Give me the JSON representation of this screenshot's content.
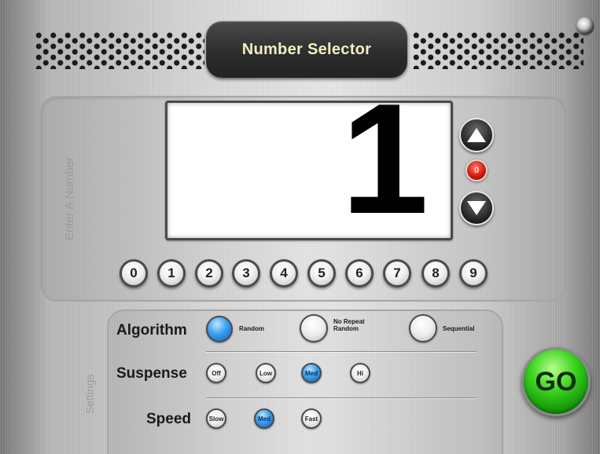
{
  "app": {
    "title": "Number Selector"
  },
  "entry": {
    "label": "Enter A Number",
    "value": "1"
  },
  "controls": {
    "reset_label": "0"
  },
  "keypad": {
    "digits": [
      "0",
      "1",
      "2",
      "3",
      "4",
      "5",
      "6",
      "7",
      "8",
      "9"
    ]
  },
  "settings": {
    "label": "Settings",
    "algorithm": {
      "label": "Algorithm",
      "options": [
        {
          "label": "Random",
          "selected": true
        },
        {
          "label": "No Repeat Random",
          "selected": false
        },
        {
          "label": "Sequential",
          "selected": false
        }
      ]
    },
    "suspense": {
      "label": "Suspense",
      "options": [
        {
          "label": "Off",
          "selected": false
        },
        {
          "label": "Low",
          "selected": false
        },
        {
          "label": "Med",
          "selected": true
        },
        {
          "label": "Hi",
          "selected": false
        }
      ]
    },
    "speed": {
      "label": "Speed",
      "options": [
        {
          "label": "Slow",
          "selected": false
        },
        {
          "label": "Med",
          "selected": true
        },
        {
          "label": "Fast",
          "selected": false
        }
      ]
    }
  },
  "go": {
    "label": "GO"
  },
  "colors": {
    "accent": "#2f97ee",
    "go": "#38d11c",
    "reset": "#d41a0c",
    "title_text": "#f2eec2"
  }
}
